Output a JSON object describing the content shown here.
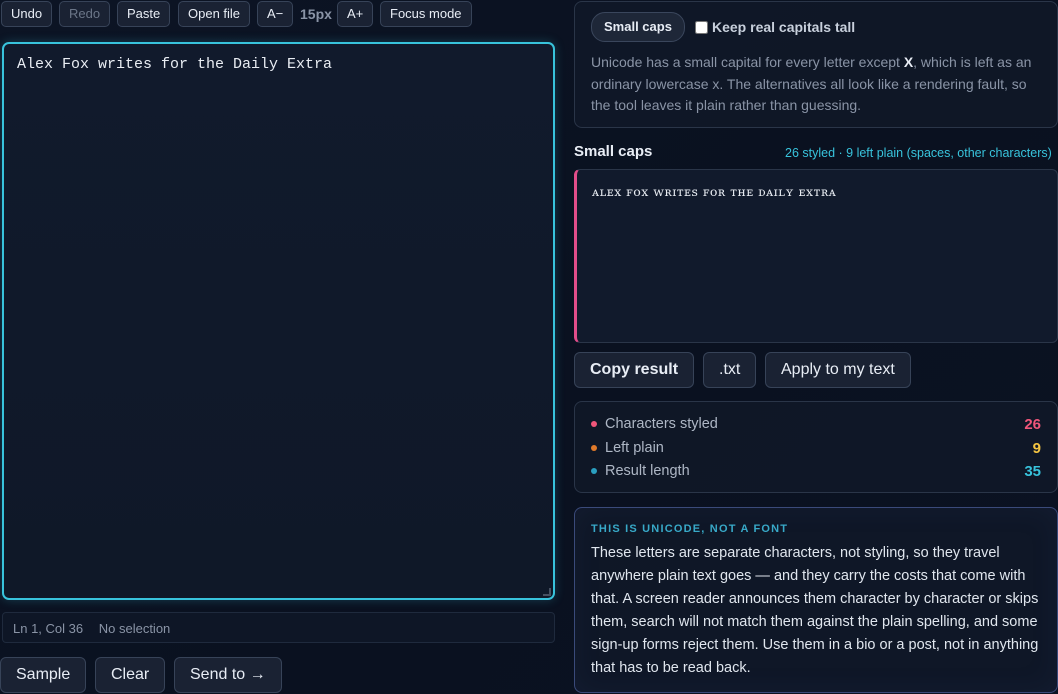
{
  "toolbar": {
    "undo": "Undo",
    "redo": "Redo",
    "paste": "Paste",
    "open_file": "Open file",
    "font_smaller": "A−",
    "font_size": "15px",
    "font_larger": "A+",
    "focus_mode": "Focus mode"
  },
  "editor": {
    "text": "Alex Fox writes for the Daily Extra"
  },
  "status": {
    "position": "Ln 1, Col 36",
    "selection": "No selection"
  },
  "bottom_actions": {
    "sample": "Sample",
    "clear": "Clear",
    "send_to": "Send to →"
  },
  "options": {
    "style_pill": "Small caps",
    "keep_capitals_label": "Keep real capitals tall",
    "keep_capitals_checked": false,
    "note_before": "Unicode has a small capital for every letter except ",
    "note_bold": "X",
    "note_after": ", which is left as an ordinary lowercase x. The alternatives all look like a rendering fault, so the tool leaves it plain rather than guessing."
  },
  "result": {
    "title": "Small caps",
    "meta": "26 styled · 9 left plain (spaces, other characters)",
    "text": "ᴀʟᴇx ꜰᴏx ᴡʀɪᴛᴇꜱ ꜰᴏʀ ᴛʜᴇ ᴅᴀɪʟʏ ᴇxᴛʀᴀ",
    "copy": "Copy result",
    "txt": ".txt",
    "apply": "Apply to my text"
  },
  "stats": [
    {
      "label": "Characters styled",
      "value": "26",
      "color": "#f0567a"
    },
    {
      "label": "Left plain",
      "value": "9",
      "color": "#f5c542",
      "dot": "#e07a2a"
    },
    {
      "label": "Result length",
      "value": "35",
      "color": "#38c3dc",
      "dot": "#2a9fc0"
    }
  ],
  "info": {
    "title": "THIS IS UNICODE, NOT A FONT",
    "body": "These letters are separate characters, not styling, so they travel anywhere plain text goes — and they carry the costs that come with that. A screen reader announces them character by character or skips them, search will not match them against the plain spelling, and some sign-up forms reject them. Use them in a bio or a post, not in anything that has to be read back."
  }
}
